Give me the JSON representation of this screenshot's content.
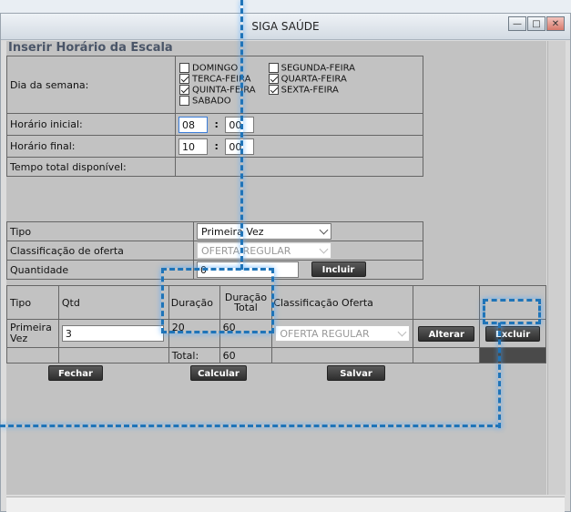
{
  "window": {
    "title": "SIGA SAÚDE",
    "buttons": [
      "—",
      "□",
      "✕"
    ]
  },
  "heading": "Inserir Horário da Escala",
  "form": {
    "dia_label": "Dia da semana:",
    "days": [
      {
        "label": "DOMINGO",
        "checked": false
      },
      {
        "label": "SEGUNDA-FEIRA",
        "checked": false
      },
      {
        "label": "TERCA-FEIRA",
        "checked": true
      },
      {
        "label": "QUARTA-FEIRA",
        "checked": true
      },
      {
        "label": "QUINTA-FEIRA",
        "checked": true
      },
      {
        "label": "SEXTA-FEIRA",
        "checked": true
      },
      {
        "label": "SABADO",
        "checked": false
      }
    ],
    "inicial_label": "Horário inicial:",
    "inicial_h": "08",
    "inicial_m": "00",
    "final_label": "Horário final:",
    "final_h": "10",
    "final_m": "00",
    "colon": ":",
    "total_label": "Tempo total disponível:"
  },
  "oferta": {
    "tipo_label": "Tipo",
    "tipo_value": "Primeira Vez",
    "classif_label": "Classificação de oferta",
    "classif_value": "OFERTA REGULAR",
    "qtd_label": "Quantidade",
    "qtd_value": "0",
    "incluir": "Incluir"
  },
  "table": {
    "headers": [
      "Tipo",
      "Qtd",
      "Duração",
      "Duração Total",
      "Classificação Oferta"
    ],
    "header_dur_total_l1": "Duração",
    "header_dur_total_l2": "Total",
    "row": {
      "tipo_l1": "Primeira",
      "tipo_l2": "Vez",
      "qtd": "3",
      "duracao": "20",
      "duracao_total": "60",
      "classif": "OFERTA REGULAR",
      "alterar": "Alterar",
      "excluir": "Excluir"
    },
    "total_label": "Total:",
    "total_value": "60"
  },
  "actions": {
    "fechar": "Fechar",
    "calcular": "Calcular",
    "salvar": "Salvar"
  },
  "colors": {
    "highlight": "#1f74b8",
    "button": "#3a3a3a"
  }
}
